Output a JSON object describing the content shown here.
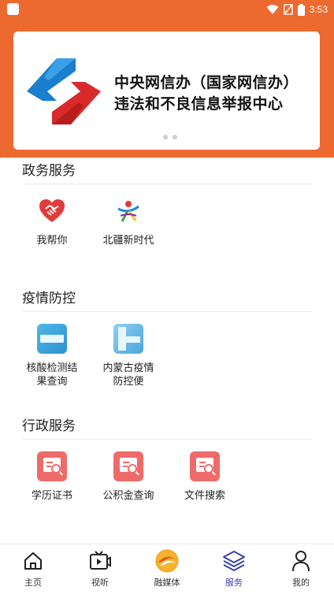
{
  "status_bar": {
    "time": "3:53"
  },
  "banner": {
    "line1": "中央网信办（国家网信办）",
    "line2": "违法和不良信息举报中心"
  },
  "sections": [
    {
      "title": "政务服务",
      "items": [
        {
          "label": "我帮你",
          "icon": "handshake-heart-icon"
        },
        {
          "label": "北疆新时代",
          "icon": "beijiang-figure-icon"
        }
      ]
    },
    {
      "title": "疫情防控",
      "items": [
        {
          "label": "核酸检测结果查询",
          "icon": "nucleic-test-icon"
        },
        {
          "label": "内蒙古疫情防控便",
          "icon": "epidemic-control-icon"
        }
      ]
    },
    {
      "title": "行政服务",
      "items": [
        {
          "label": "学历证书",
          "icon": "document-search-icon"
        },
        {
          "label": "公积金查询",
          "icon": "document-search-icon"
        },
        {
          "label": "文件搜索",
          "icon": "document-search-icon"
        }
      ]
    }
  ],
  "nav": {
    "items": [
      {
        "label": "主页",
        "icon": "home-icon"
      },
      {
        "label": "视听",
        "icon": "tv-play-icon"
      },
      {
        "label": "融媒体",
        "icon": "media-logo-icon"
      },
      {
        "label": "服务",
        "icon": "layers-icon"
      },
      {
        "label": "我的",
        "icon": "user-icon"
      }
    ],
    "active_index": 3
  },
  "colors": {
    "header": "#ec6a2f",
    "active_nav": "#3a3fb0",
    "tile_red": "#ef6a6a"
  }
}
